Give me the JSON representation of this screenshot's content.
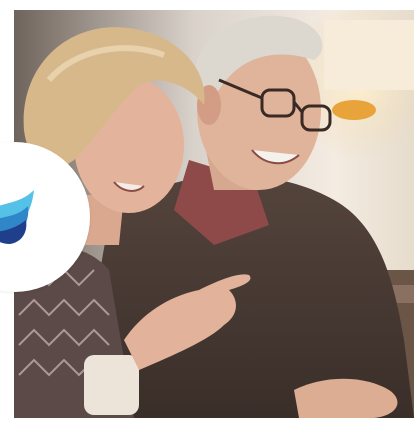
{
  "photo": {
    "subject-icon": "elderly-couple-photo"
  },
  "badge": {
    "icon": "wave-logo-icon",
    "colors": {
      "logo_light": "#56c1e6",
      "logo_mid": "#2f86c8",
      "logo_dark": "#1f3f8c"
    }
  },
  "colors": {
    "background": "#ffffff",
    "photo_shadow": "#3a2e28",
    "sweater": "#4a3b34",
    "skin": "#e2b49a",
    "hair_woman": "#d8b98c",
    "hair_man": "#d9d4cc",
    "lamp_glow": "#f6e6c8",
    "wall": "#ece7e1"
  }
}
